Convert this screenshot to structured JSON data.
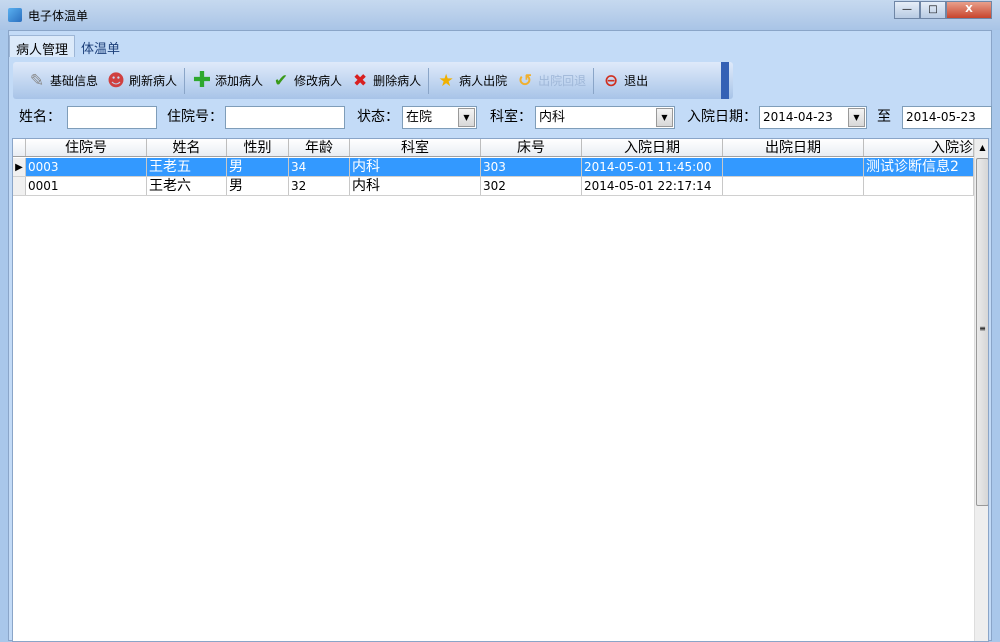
{
  "window": {
    "title": "电子体温单",
    "minimize": "—",
    "maximize": "□",
    "close": "X"
  },
  "tabs": [
    {
      "label": "病人管理"
    },
    {
      "label": "体温单"
    }
  ],
  "toolbar": {
    "items": [
      {
        "label": "基础信息",
        "icon": "tools-icon"
      },
      {
        "label": "刷新病人",
        "icon": "users-icon"
      },
      {
        "label": "添加病人",
        "icon": "plus-icon"
      },
      {
        "label": "修改病人",
        "icon": "check-icon"
      },
      {
        "label": "删除病人",
        "icon": "delete-icon"
      },
      {
        "label": "病人出院",
        "icon": "person-walk-icon"
      },
      {
        "label": "出院回退",
        "icon": "undo-icon"
      },
      {
        "label": "退出",
        "icon": "exit-icon"
      }
    ]
  },
  "filters": {
    "name_label": "姓名：",
    "name_value": "",
    "admission_no_label": "住院号：",
    "admission_no_value": "",
    "status_label": "状态：",
    "status_value": "在院",
    "dept_label": "科室：",
    "dept_value": "内科",
    "date_label": "入院日期：",
    "date_from": "2014-04-23",
    "to_label": "至",
    "date_to": "2014-05-23"
  },
  "grid": {
    "columns": [
      "住院号",
      "姓名",
      "性别",
      "年龄",
      "科室",
      "床号",
      "入院日期",
      "出院日期",
      "入院诊"
    ],
    "rows": [
      [
        "0003",
        "王老五",
        "男",
        "34",
        "内科",
        "303",
        "2014-05-01 11:45:00",
        "",
        "测试诊断信息2"
      ],
      [
        "0001",
        "王老六",
        "男",
        "32",
        "内科",
        "302",
        "2014-05-01 22:17:14",
        "",
        ""
      ]
    ],
    "selected_row": 0
  }
}
